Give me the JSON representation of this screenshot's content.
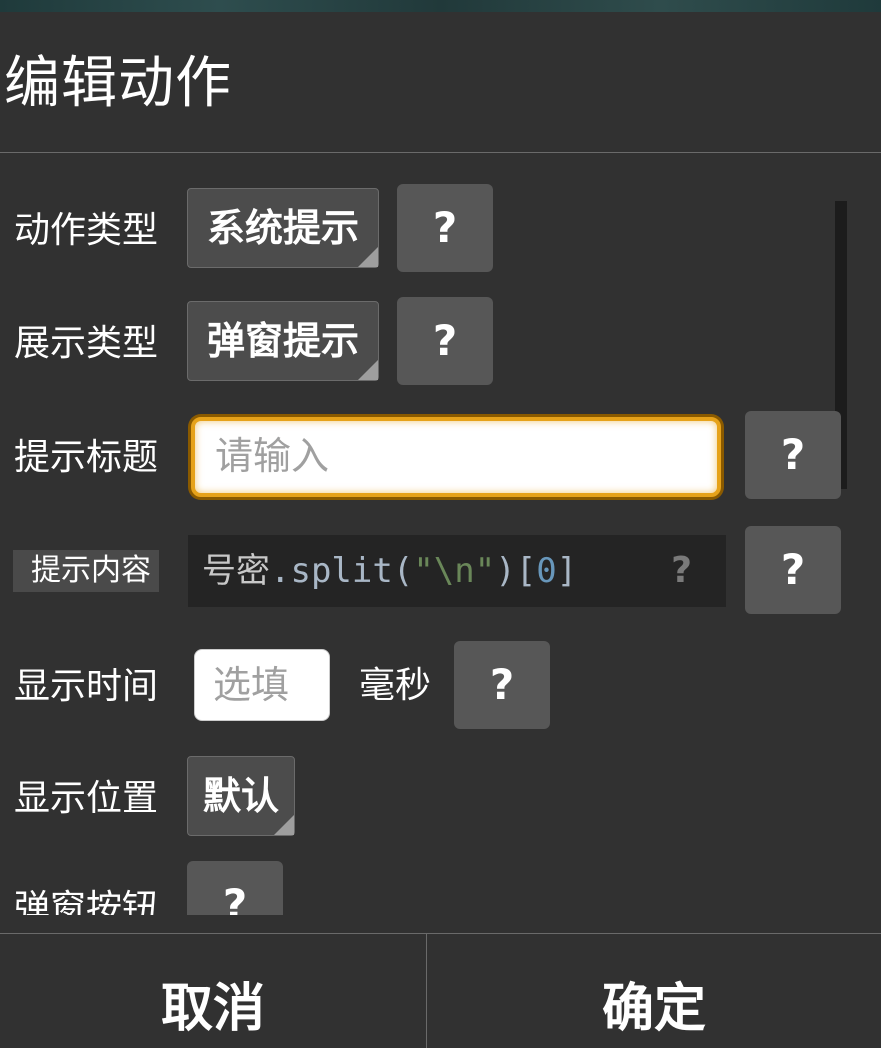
{
  "dialog": {
    "title": "编辑动作",
    "cancel_label": "取消",
    "confirm_label": "确定"
  },
  "form": {
    "action_type": {
      "label": "动作类型",
      "value": "系统提示",
      "help": "?"
    },
    "display_type": {
      "label": "展示类型",
      "value": "弹窗提示",
      "help": "?"
    },
    "prompt_title": {
      "label": "提示标题",
      "placeholder": "请输入",
      "help": "?"
    },
    "prompt_content": {
      "label": "提示内容",
      "code": {
        "prefix": "号密",
        "dot": ".",
        "method": "split",
        "open_paren": "(",
        "string": "\"\\n\"",
        "close_paren": ")",
        "open_bracket": "[",
        "index": "0",
        "close_bracket": "]"
      },
      "inline_hint": "?",
      "help": "?"
    },
    "display_time": {
      "label": "显示时间",
      "placeholder": "选填",
      "unit": "毫秒",
      "help": "?"
    },
    "display_position": {
      "label": "显示位置",
      "value": "默认"
    },
    "popup_button": {
      "label": "弹窗按钮",
      "help": "?"
    }
  }
}
